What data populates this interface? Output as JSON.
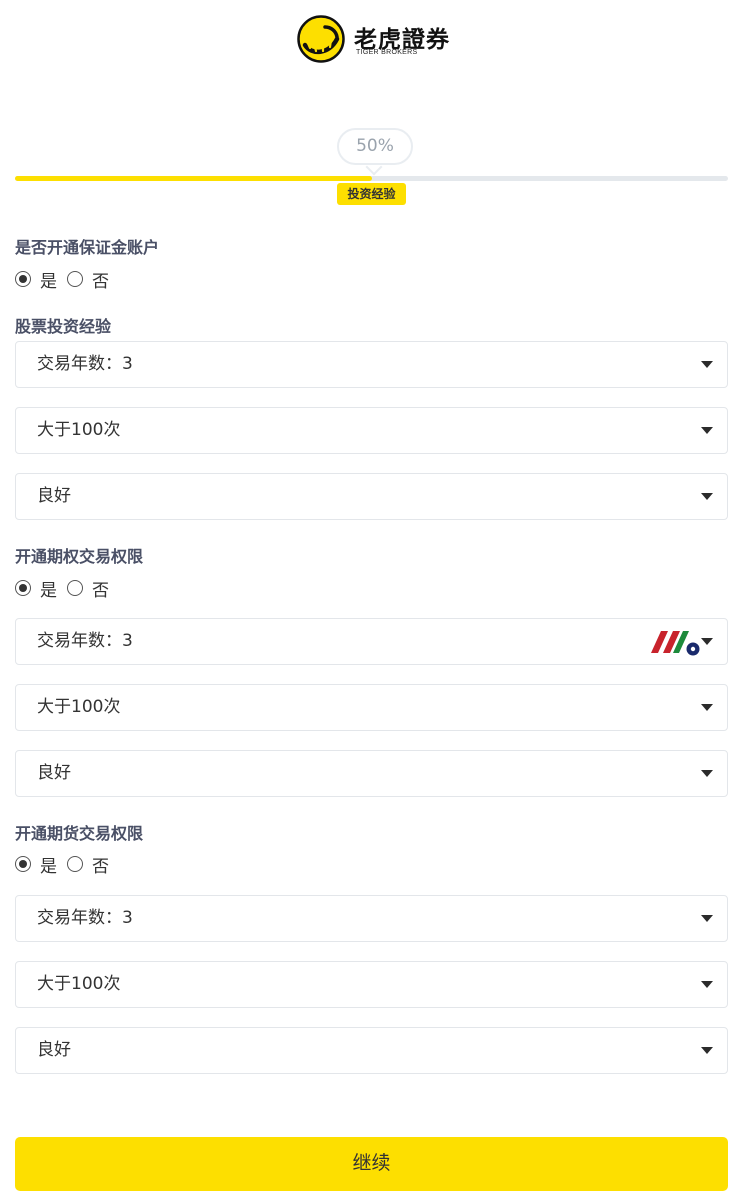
{
  "header": {
    "brand_cn": "老虎證券",
    "brand_en": "TIGER BROKERS"
  },
  "progress": {
    "percent_text": "50%",
    "value": 0.5,
    "stage_label": "投资经验",
    "fill_color": "#fddf00"
  },
  "margin_account": {
    "title": "是否开通保证金账户",
    "options": [
      "是",
      "否"
    ],
    "selected": "是"
  },
  "stock_experience": {
    "title": "股票投资经验",
    "years": "交易年数：3",
    "frequency": "大于100次",
    "knowledge": "良好"
  },
  "options_permission": {
    "title": "开通期权交易权限",
    "options": [
      "是",
      "否"
    ],
    "selected": "是",
    "years": "交易年数：3",
    "frequency": "大于100次",
    "knowledge": "良好"
  },
  "futures_permission": {
    "title": "开通期货交易权限",
    "options": [
      "是",
      "否"
    ],
    "selected": "是",
    "years": "交易年数：3",
    "frequency": "大于100次",
    "knowledge": "良好"
  },
  "footer": {
    "continue_label": "继续"
  },
  "icons": {
    "logo": "tiger-logo-icon",
    "dropdown": "caret-down-icon",
    "radio": "radio-icon",
    "watermark": "watermark-logo-icon"
  },
  "colors": {
    "accent": "#fddf00",
    "title_text": "#4a5066",
    "border": "#e3e6ea"
  }
}
